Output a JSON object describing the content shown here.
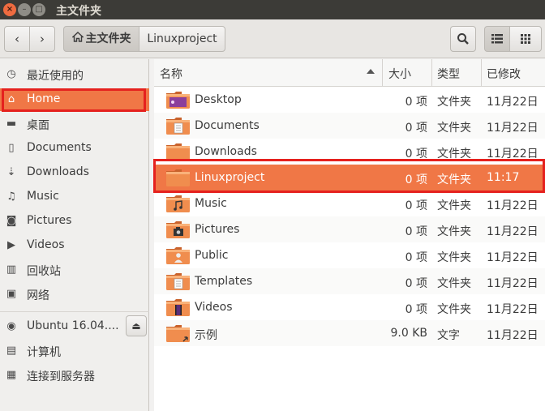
{
  "window": {
    "title": "主文件夹",
    "close_glyph": "×",
    "min_glyph": "–",
    "max_glyph": "□"
  },
  "toolbar": {
    "back_icon": "chevron-left-icon",
    "forward_icon": "chevron-right-icon",
    "back_glyph": "‹",
    "forward_glyph": "›",
    "path": [
      {
        "label": "主文件夹",
        "icon": "home-icon"
      },
      {
        "label": "Linuxproject"
      }
    ],
    "search_glyph": "⌕",
    "list_glyph": "☰",
    "grid_glyph": "⠿"
  },
  "sidebar": {
    "items": [
      {
        "label": "最近使用的",
        "icon": "clock-icon",
        "glyph": "◷"
      },
      {
        "label": "Home",
        "icon": "home-icon",
        "glyph": "⌂",
        "active": true
      },
      {
        "label": "桌面",
        "icon": "folder-icon",
        "glyph": "▬"
      },
      {
        "label": "Documents",
        "icon": "document-icon",
        "glyph": "▯"
      },
      {
        "label": "Downloads",
        "icon": "download-icon",
        "glyph": "⇣"
      },
      {
        "label": "Music",
        "icon": "music-icon",
        "glyph": "♫"
      },
      {
        "label": "Pictures",
        "icon": "camera-icon",
        "glyph": "◙"
      },
      {
        "label": "Videos",
        "icon": "video-icon",
        "glyph": "▶"
      },
      {
        "label": "回收站",
        "icon": "trash-icon",
        "glyph": "▥"
      },
      {
        "label": "网络",
        "icon": "network-icon",
        "glyph": "▣"
      },
      {
        "label": "Ubuntu 16.04....",
        "icon": "disc-icon",
        "glyph": "◉"
      },
      {
        "label": "计算机",
        "icon": "computer-icon",
        "glyph": "▤"
      },
      {
        "label": "连接到服务器",
        "icon": "server-icon",
        "glyph": "▦"
      }
    ],
    "eject_glyph": "⏏"
  },
  "columns": {
    "name": "名称",
    "size": "大小",
    "type": "类型",
    "modified": "已修改"
  },
  "files": [
    {
      "name": "Desktop",
      "size": "0 项",
      "type": "文件夹",
      "modified": "11月22日",
      "icon": "desktop-folder-icon",
      "emblem": "purple"
    },
    {
      "name": "Documents",
      "size": "0 项",
      "type": "文件夹",
      "modified": "11月22日",
      "icon": "documents-folder-icon",
      "emblem": "doc"
    },
    {
      "name": "Downloads",
      "size": "0 项",
      "type": "文件夹",
      "modified": "11月22日",
      "icon": "downloads-folder-icon",
      "emblem": "none"
    },
    {
      "name": "Linuxproject",
      "size": "0 项",
      "type": "文件夹",
      "modified": "11:17",
      "icon": "folder-icon",
      "emblem": "none",
      "selected": true
    },
    {
      "name": "Music",
      "size": "0 项",
      "type": "文件夹",
      "modified": "11月22日",
      "icon": "music-folder-icon",
      "emblem": "music"
    },
    {
      "name": "Pictures",
      "size": "0 项",
      "type": "文件夹",
      "modified": "11月22日",
      "icon": "pictures-folder-icon",
      "emblem": "pic"
    },
    {
      "name": "Public",
      "size": "0 项",
      "type": "文件夹",
      "modified": "11月22日",
      "icon": "public-folder-icon",
      "emblem": "user"
    },
    {
      "name": "Templates",
      "size": "0 项",
      "type": "文件夹",
      "modified": "11月22日",
      "icon": "templates-folder-icon",
      "emblem": "doc"
    },
    {
      "name": "Videos",
      "size": "0 项",
      "type": "文件夹",
      "modified": "11月22日",
      "icon": "videos-folder-icon",
      "emblem": "film"
    },
    {
      "name": "示例",
      "size": "9.0 KB",
      "type": "文字",
      "modified": "11月22日",
      "icon": "examples-link-folder-icon",
      "emblem": "link"
    }
  ]
}
